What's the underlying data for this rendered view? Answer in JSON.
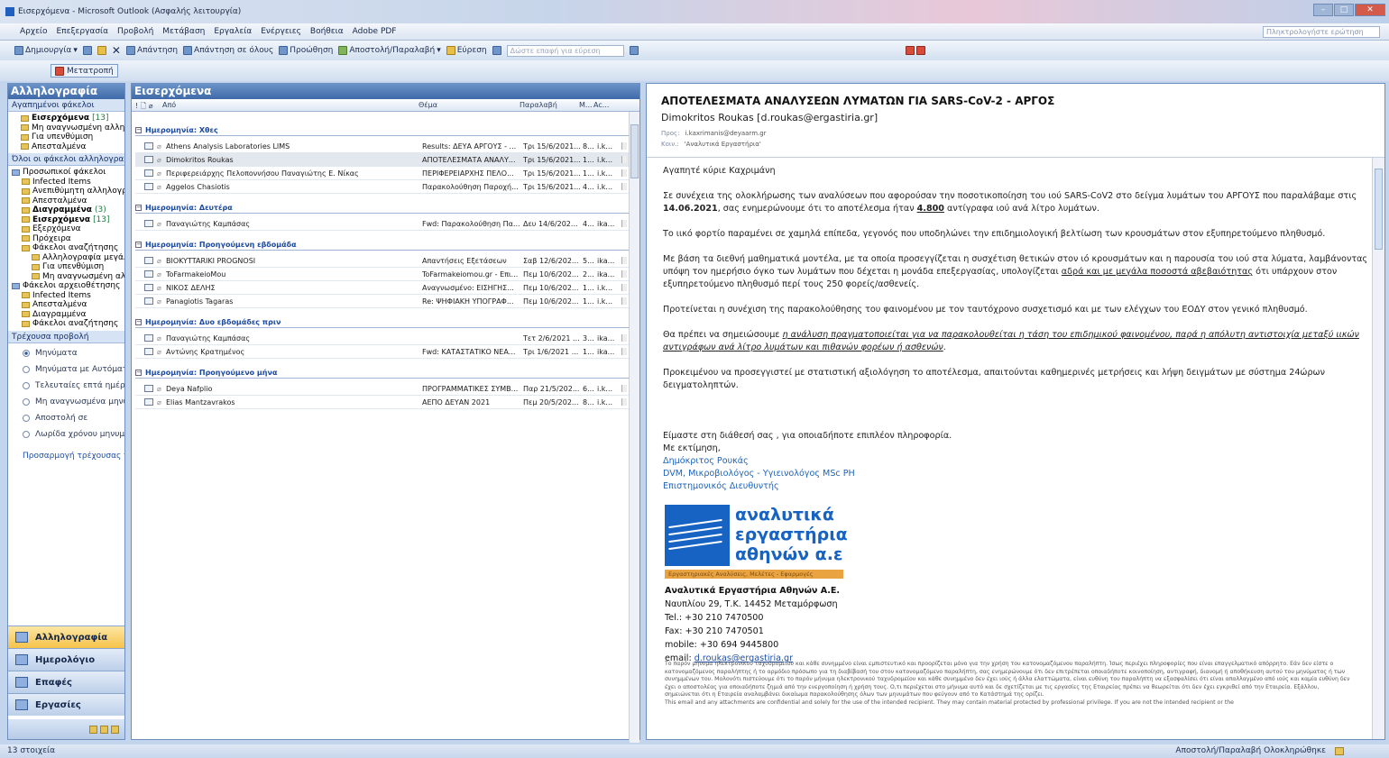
{
  "window": {
    "title": "Εισερχόμενα - Microsoft Outlook (Ασφαλής λειτουργία)"
  },
  "menu": [
    "Αρχείο",
    "Επεξεργασία",
    "Προβολή",
    "Μετάβαση",
    "Εργαλεία",
    "Ενέργειες",
    "Βοήθεια",
    "Adobe PDF"
  ],
  "help_placeholder": "Πληκτρολογήστε ερώτηση",
  "toolbar": {
    "new": "Δημιουργία",
    "reply": "Απάντηση",
    "reply_all": "Απάντηση σε όλους",
    "forward": "Προώθηση",
    "send_receive": "Αποστολή/Παραλαβή",
    "find": "Εύρεση",
    "search_placeholder": "Δώστε επαφή για εύρεση",
    "convert": "Μετατροπή"
  },
  "nav": {
    "header": "Αλληλογραφία",
    "favorites_header": "Αγαπημένοι φάκελοι",
    "favorites": [
      {
        "label": "Εισερχόμενα",
        "count": "[13]",
        "bold": true
      },
      {
        "label": "Μη αναγνωσμένη αλληλογραφία"
      },
      {
        "label": "Για υπενθύμιση"
      },
      {
        "label": "Απεσταλμένα"
      }
    ],
    "all_header": "Όλοι οι φάκελοι αλληλογραφίας",
    "folders": [
      {
        "label": "Προσωπικοί φάκελοι",
        "indent": 0
      },
      {
        "label": "Infected Items",
        "indent": 1
      },
      {
        "label": "Ανεπιθύμητη αλληλογραφία",
        "indent": 1
      },
      {
        "label": "Απεσταλμένα",
        "indent": 1
      },
      {
        "label": "Διαγραμμένα",
        "count": "(3)",
        "indent": 1,
        "bold": true
      },
      {
        "label": "Εισερχόμενα",
        "count": "[13]",
        "indent": 1,
        "bold": true
      },
      {
        "label": "Εξερχόμενα",
        "indent": 1
      },
      {
        "label": "Πρόχειρα",
        "indent": 1
      },
      {
        "label": "Φάκελοι αναζήτησης",
        "indent": 1
      },
      {
        "label": "Αλληλογραφία μεγάλου μεγέθους",
        "indent": 2
      },
      {
        "label": "Για υπενθύμιση",
        "indent": 2
      },
      {
        "label": "Μη αναγνωσμένη αλληλογραφία",
        "indent": 2
      },
      {
        "label": "Φάκελοι αρχειοθέτησης",
        "indent": 0
      },
      {
        "label": "Infected Items",
        "indent": 1
      },
      {
        "label": "Απεσταλμένα",
        "indent": 1
      },
      {
        "label": "Διαγραμμένα",
        "indent": 1
      },
      {
        "label": "Φάκελοι αναζήτησης",
        "indent": 1
      }
    ],
    "view_header": "Τρέχουσα προβολή",
    "views": [
      {
        "label": "Μηνύματα",
        "selected": true
      },
      {
        "label": "Μηνύματα με Αυτόματη προεπισκόπηση"
      },
      {
        "label": "Τελευταίες επτά ημέρες"
      },
      {
        "label": "Μη αναγνωσμένα μηνύματα"
      },
      {
        "label": "Αποστολή σε"
      },
      {
        "label": "Λωρίδα χρόνου μηνυμάτων"
      }
    ],
    "customize": "Προσαρμογή τρέχουσας προβολής",
    "buttons": [
      "Αλληλογραφία",
      "Ημερολόγιο",
      "Επαφές",
      "Εργασίες"
    ]
  },
  "list": {
    "header": "Εισερχόμενα",
    "columns": {
      "from": "Από",
      "subject": "Θέμα",
      "received": "Παραλαβή",
      "size": "Μ...",
      "cat": "Ac..."
    },
    "groups": [
      {
        "label": "Ημερομηνία: Χθες",
        "rows": [
          {
            "from": "Athens Analysis Laboratories LIMS",
            "subject": "Results: ΔΕΥΑ ΑΡΓΟΥΣ - ...",
            "received": "Τρι 15/6/2021...",
            "size": "8...",
            "cat": "i.k..."
          },
          {
            "from": "Dimokritos Roukas",
            "subject": "ΑΠΟΤΕΛΕΣΜΑΤΑ ΑΝΑΛΥ...",
            "received": "Τρι 15/6/2021...",
            "size": "1...",
            "cat": "i.k...",
            "selected": true
          },
          {
            "from": "Περιφερειάρχης Πελοποννήσου Παναγιώτης Ε. Νίκας",
            "subject": "ΠΕΡΙΦΕΡΕΙΑΡΧΗΣ ΠΕΛΟ...",
            "received": "Τρι 15/6/2021...",
            "size": "1...",
            "cat": "i.k..."
          },
          {
            "from": "Aggelos Chasiotis",
            "subject": "Παρακολούθηση Παροχή...",
            "received": "Τρι 15/6/2021...",
            "size": "4...",
            "cat": "i.k..."
          }
        ]
      },
      {
        "label": "Ημερομηνία: Δευτέρα",
        "rows": [
          {
            "from": "Παναγιώτης Καμπάσας",
            "subject": "Fwd: Παρακολούθηση Πα...",
            "received": "Δευ 14/6/202...",
            "size": "4...",
            "cat": "ika..."
          }
        ]
      },
      {
        "label": "Ημερομηνία: Προηγούμενη εβδομάδα",
        "rows": [
          {
            "from": "BIOKYTTARIKI PROGNOSI",
            "subject": "Απαντήσεις Εξετάσεων",
            "received": "Σαβ 12/6/202...",
            "size": "5...",
            "cat": "ika..."
          },
          {
            "from": "ToFarmakeioMou",
            "subject": "ToFarmakeiomou.gr - Επι...",
            "received": "Πεμ 10/6/202...",
            "size": "2...",
            "cat": "ika..."
          },
          {
            "from": "ΝΙΚΟΣ ΔΕΛΗΣ",
            "subject": "Αναγνωσμένο: ΕΙΣΗΓΗΣ...",
            "received": "Πεμ 10/6/202...",
            "size": "1...",
            "cat": "i.k..."
          },
          {
            "from": "Panagiotis Tagaras",
            "subject": "Re: ΨΗΦΙΑΚΗ ΥΠΟΓΡΑΦ...",
            "received": "Πεμ 10/6/202...",
            "size": "1...",
            "cat": "i.k..."
          }
        ]
      },
      {
        "label": "Ημερομηνία: Δυο εβδομάδες πριν",
        "rows": [
          {
            "from": "Παναγιώτης Καμπάσας",
            "subject": "",
            "received": "Τετ 2/6/2021 ...",
            "size": "3...",
            "cat": "ika..."
          },
          {
            "from": "Αντώνης Κρατημένος",
            "subject": "Fwd: ΚΑΤΑΣΤΑΤΙΚΟ ΝΕΑ...",
            "received": "Τρι 1/6/2021 ...",
            "size": "1...",
            "cat": "ika..."
          }
        ]
      },
      {
        "label": "Ημερομηνία: Προηγούμενο μήνα",
        "rows": [
          {
            "from": "Deya Nafplio",
            "subject": "ΠΡΟΓΡΑΜΜΑΤΙΚΕΣ ΣΥΜΒ...",
            "received": "Παρ 21/5/202...",
            "size": "6...",
            "cat": "i.k..."
          },
          {
            "from": "Elias Mantzavrakos",
            "subject": "ΑΕΠΟ ΔΕΥΑΝ 2021",
            "received": "Πεμ 20/5/202...",
            "size": "8...",
            "cat": "i.k..."
          }
        ]
      }
    ]
  },
  "message": {
    "subject": "ΑΠΟΤΕΛΕΣΜΑΤΑ ΑΝΑΛΥΣΕΩΝ ΛΥΜΑΤΩΝ ΓΙΑ SARS-CoV-2 - ΑΡΓΟΣ",
    "sender": "Dimokritos Roukas [d.roukas@ergastiria.gr]",
    "to_label": "Προς:",
    "to": "i.kaxrimanis@deyaarm.gr",
    "cc_label": "Κοιν.:",
    "cc": "'Αναλυτικά Εργαστήρια'",
    "greeting": "Αγαπητέ κύριε Καχριμάνη",
    "p1a": "Σε συνέχεια της ολοκλήρωσης των αναλύσεων που αφορούσαν την ποσοτικοποίηση του ιού SARS-CoV2 στο δείγμα λυμάτων του ΑΡΓΟΥΣ που παραλάβαμε στις ",
    "p1date": "14.06.2021",
    "p1b": ", σας ενημερώνουμε ότι το αποτέλεσμα ήταν ",
    "p1val": "4.800",
    "p1c": " αντίγραφα ιού ανά λίτρο λυμάτων.",
    "p2": "Το ιικό φορτίο παραμένει σε χαμηλά επίπεδα, γεγονός που υποδηλώνει την επιδημιολογική βελτίωση των κρουσμάτων στον εξυπηρετούμενο πληθυσμό.",
    "p3a": "Με βάση τα διεθνή μαθηματικά μοντέλα, με τα οποία προσεγγίζεται η συσχέτιση θετικών στον ιό κρουσμάτων και η παρουσία του ιού στα λύματα, λαμβάνοντας υπόψη τον ημερήσιο όγκο των λυμάτων που δέχεται η μονάδα επεξεργασίας, υπολογίζεται ",
    "p3u": "αδρά και με μεγάλα ποσοστά αβεβαιότητας",
    "p3b": " ότι υπάρχουν στον εξυπηρετούμενο πληθυσμό περί τους 250 φορείς/ασθενείς.",
    "p4": "Προτείνεται η συνέχιση της παρακολούθησης του φαινομένου με τον ταυτόχρονο συσχετισμό  και με των ελέγχων του ΕΟΔΥ στον γενικό πληθυσμό.",
    "p5a": "Θα πρέπει να σημειώσουμε ",
    "p5i": "η ανάλυση πραγματοποιείται για να παρακολουθείται η τάση του επιδημικού φαινομένου, παρά η απόλυτη αντιστοιχία μεταξύ ιικών αντιγράφων ανά λίτρο λυμάτων και πιθανών φορέων ή ασθενών",
    "p5b": ".",
    "p6": "Προκειμένου να προσεγγιστεί με στατιστική αξιολόγηση το αποτέλεσμα, απαιτούνται καθημερινές μετρήσεις και λήψη δειγμάτων με σύστημα 24ώρων δειγματοληπτών.",
    "closing1": "Είμαστε στη διάθεσή σας , για οποιαδήποτε επιπλέον πληροφορία.",
    "closing2": "Με εκτίμηση,",
    "sig_name": "Δημόκριτος Ρουκάς",
    "sig_title": "DVM, Μικροβιολόγος - Υγιεινολόγος MSc PH",
    "sig_role": "Επιστημονικός Διευθυντής",
    "logo_lines": [
      "αναλυτικά",
      "εργαστήρια",
      "αθηνών α.ε"
    ],
    "logo_tag": "Εργαστηριακές Αναλύσεις, Μελέτες - Εφαρμογές",
    "company": "Αναλυτικά Εργαστήρια Αθηνών Α.Ε.",
    "address": "Ναυπλίου 29, Τ.Κ. 14452 Μεταμόρφωση",
    "tel": "Tel.: +30 210 7470500",
    "fax": "Fax: +30 210 7470501",
    "mobile": "mobile: +30 694 9445800",
    "email_label": "email: ",
    "email": "d.roukas@ergastiria.gr",
    "disclaimer_gr": "Το παρόν μήνυμα ηλεκτρονικού ταχυδρομείου και κάθε συνημμένο είναι εμπιστευτικό και προορίζεται μόνο για την χρήση του κατονομαζόμενου παραλήπτη. Ίσως περιέχει πληροφορίες που είναι επαγγελματικό απόρρητο. Εάν δεν είστε ο κατονομαζόμενος παραλήπτης ή το αρμόδιο πρόσωπο για τη διαβίβασή του στον κατονομαζόμενο παραλήπτη, σας ενημερώνουμε ότι δεν επιτρέπεται οποιαδήποτε κοινοποίηση, αντιγραφή, διανομή ή αποθήκευση αυτού του μηνύματος ή των συνημμένων του. Μολονότι πιστεύουμε ότι το παρόν μήνυμα ηλεκτρονικού ταχυδρομείου και κάθε συνημμένο δεν έχει ιούς ή άλλα ελαττώματα, είναι ευθύνη του παραλήπτη να εξασφαλίσει ότι είναι απαλλαγμένο από ιούς και καμία ευθύνη δεν έχει ο αποστολέας για οποιαδήποτε ζημιά από την ενεργοποίηση ή χρήση τους. Ο,τι περιέχεται στο μήνυμα αυτό και δε σχετίζεται με τις εργασίες της Εταιρείας πρέπει να θεωρείται ότι δεν έχει εγκριθεί από την Εταιρεία. Εξάλλου, σημειώνεται ότι η Εταιρεία αναλαμβάνει δικαίωμα παρακολούθησης όλων των μηνυμάτων που φεύγουν από το Κατάστημά της ορίζει.",
    "disclaimer_en": "This email and any attachments are confidential and solely for the use of the intended recipient. They may contain material protected by professional privilege. If you are not the intended recipient or the"
  },
  "status": {
    "items": "13 στοιχεία",
    "sync": "Αποστολή/Παραλαβή Ολοκληρώθηκε"
  }
}
